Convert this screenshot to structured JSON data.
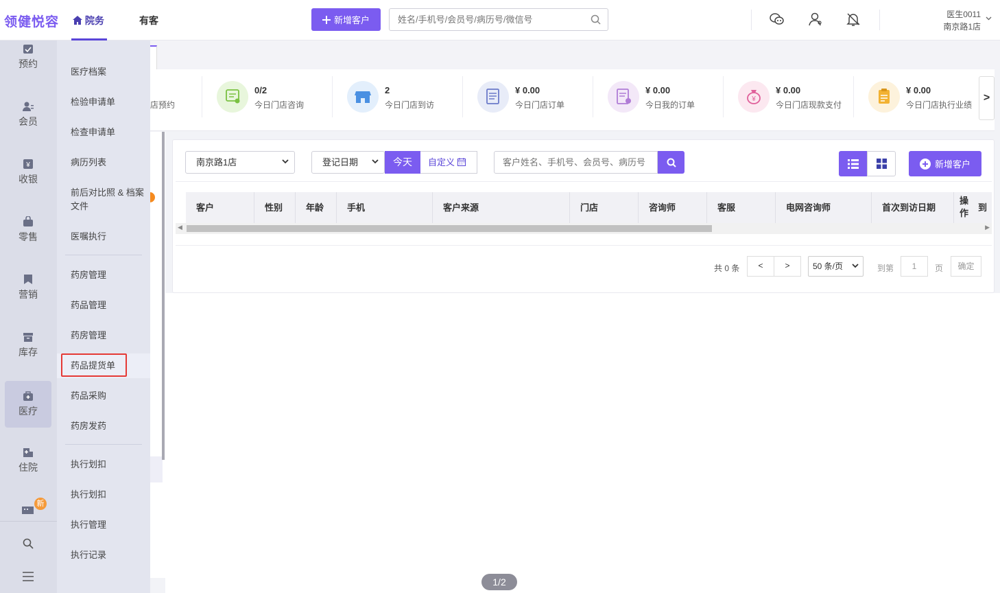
{
  "app": {
    "logo": "领健悦容"
  },
  "topnav": {
    "tabs": [
      {
        "label": "院务"
      },
      {
        "label": "有客"
      }
    ],
    "add_customer": "新增客户",
    "search_placeholder": "姓名/手机号/会员号/病历号/微信号",
    "user": {
      "name": "医生0011",
      "store": "南京路1店"
    }
  },
  "sidebar": {
    "items": [
      {
        "label": "预约",
        "icon": "calendar-icon"
      },
      {
        "label": "会员",
        "icon": "members-icon"
      },
      {
        "label": "收银",
        "icon": "cashier-icon"
      },
      {
        "label": "零售",
        "icon": "bag-icon"
      },
      {
        "label": "营销",
        "icon": "marketing-icon"
      },
      {
        "label": "库存",
        "icon": "inventory-icon"
      },
      {
        "label": "医疗",
        "icon": "medical-kit-icon"
      },
      {
        "label": "住院",
        "icon": "hospital-icon"
      }
    ],
    "badge": "新"
  },
  "submenu": {
    "items": [
      "医疗档案",
      "检验申请单",
      "检查申请单",
      "病历列表",
      "前后对比照 & 档案文件",
      "医嘱执行",
      "药房管理",
      "药品管理",
      "药房管理",
      "药品提货单",
      "药品采购",
      "药房发药",
      "执行划扣",
      "执行划扣",
      "执行管理",
      "执行记录"
    ]
  },
  "stats": [
    {
      "value": "",
      "label": "店预约",
      "color": "#ffffff"
    },
    {
      "value": "0/2",
      "label": "今日门店咨询",
      "color": "#e8f6dc"
    },
    {
      "value": "2",
      "label": "今日门店到访",
      "color": "#e3effc"
    },
    {
      "value": "¥ 0.00",
      "label": "今日门店订单",
      "color": "#e8ecf8"
    },
    {
      "value": "¥ 0.00",
      "label": "今日我的订单",
      "color": "#f3e8f8"
    },
    {
      "value": "¥ 0.00",
      "label": "今日门店现款支付",
      "color": "#fce8f0"
    },
    {
      "value": "¥ 0.00",
      "label": "今日门店执行业绩",
      "color": "#fdf2dc"
    }
  ],
  "stats_next": ">",
  "filters": {
    "store": "南京路1店",
    "date_type": "登记日期",
    "today": "今天",
    "custom": "自定义",
    "search_placeholder": "客户姓名、手机号、会员号、病历号",
    "add_customer": "新增客户"
  },
  "table": {
    "columns": [
      "客户",
      "性别",
      "年龄",
      "手机",
      "客户来源",
      "门店",
      "咨询师",
      "客服",
      "电网咨询师",
      "首次到访日期",
      "操作",
      "到"
    ]
  },
  "pagination": {
    "total": "共 0 条",
    "prev": "<",
    "next": ">",
    "page_size": "50 条/页",
    "goto": "到第",
    "page_value": "1",
    "page_unit": "页",
    "confirm": "确定"
  },
  "page_indicator": "1/2"
}
